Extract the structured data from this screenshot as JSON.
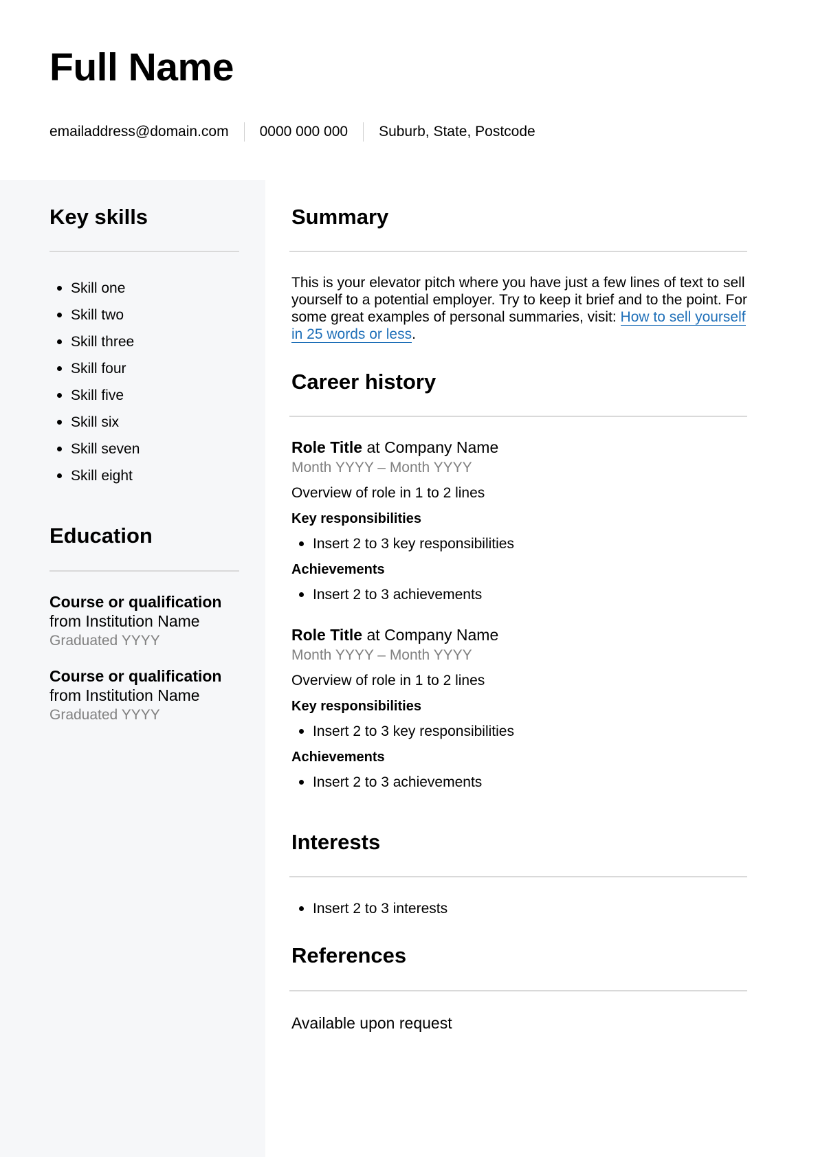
{
  "header": {
    "full_name": "Full Name",
    "email": "emailaddress@domain.com",
    "phone": "0000 000 000",
    "location": "Suburb, State, Postcode"
  },
  "sidebar": {
    "skills_title": "Key skills",
    "skills": [
      "Skill one",
      "Skill two",
      "Skill three",
      "Skill four",
      "Skill five",
      "Skill six",
      "Skill seven",
      "Skill eight"
    ],
    "education_title": "Education",
    "education": [
      {
        "course": "Course or qualification",
        "institution": "from Institution Name",
        "graduated": "Graduated YYYY"
      },
      {
        "course": "Course or qualification",
        "institution": "from Institution Name",
        "graduated": "Graduated YYYY"
      }
    ]
  },
  "main": {
    "summary_title": "Summary",
    "summary_text": "This is your elevator pitch where you have just a few lines of text to sell yourself to a potential employer. Try to keep it brief and to the point. For some great examples of personal summaries, visit: ",
    "summary_link_text": "How to sell yourself in 25 words or less",
    "summary_trailing": ".",
    "link_color": "#1e6fb8",
    "career_title": "Career history",
    "roles": [
      {
        "title": "Role Title",
        "company": " at Company Name",
        "dates": "Month YYYY – Month YYYY",
        "overview": "Overview of role in 1 to 2 lines",
        "responsibilities_label": "Key responsibilities",
        "responsibilities": [
          "Insert 2 to 3 key responsibilities"
        ],
        "achievements_label": "Achievements",
        "achievements": [
          "Insert 2 to 3 achievements"
        ]
      },
      {
        "title": "Role Title",
        "company": " at Company Name",
        "dates": "Month YYYY – Month YYYY",
        "overview": "Overview of role in 1 to 2 lines",
        "responsibilities_label": "Key responsibilities",
        "responsibilities": [
          "Insert 2 to 3 key responsibilities"
        ],
        "achievements_label": "Achievements",
        "achievements": [
          "Insert 2 to 3 achievements"
        ]
      }
    ],
    "interests_title": "Interests",
    "interests": [
      "Insert 2 to 3 interests"
    ],
    "references_title": "References",
    "references_text": "Available upon request"
  }
}
